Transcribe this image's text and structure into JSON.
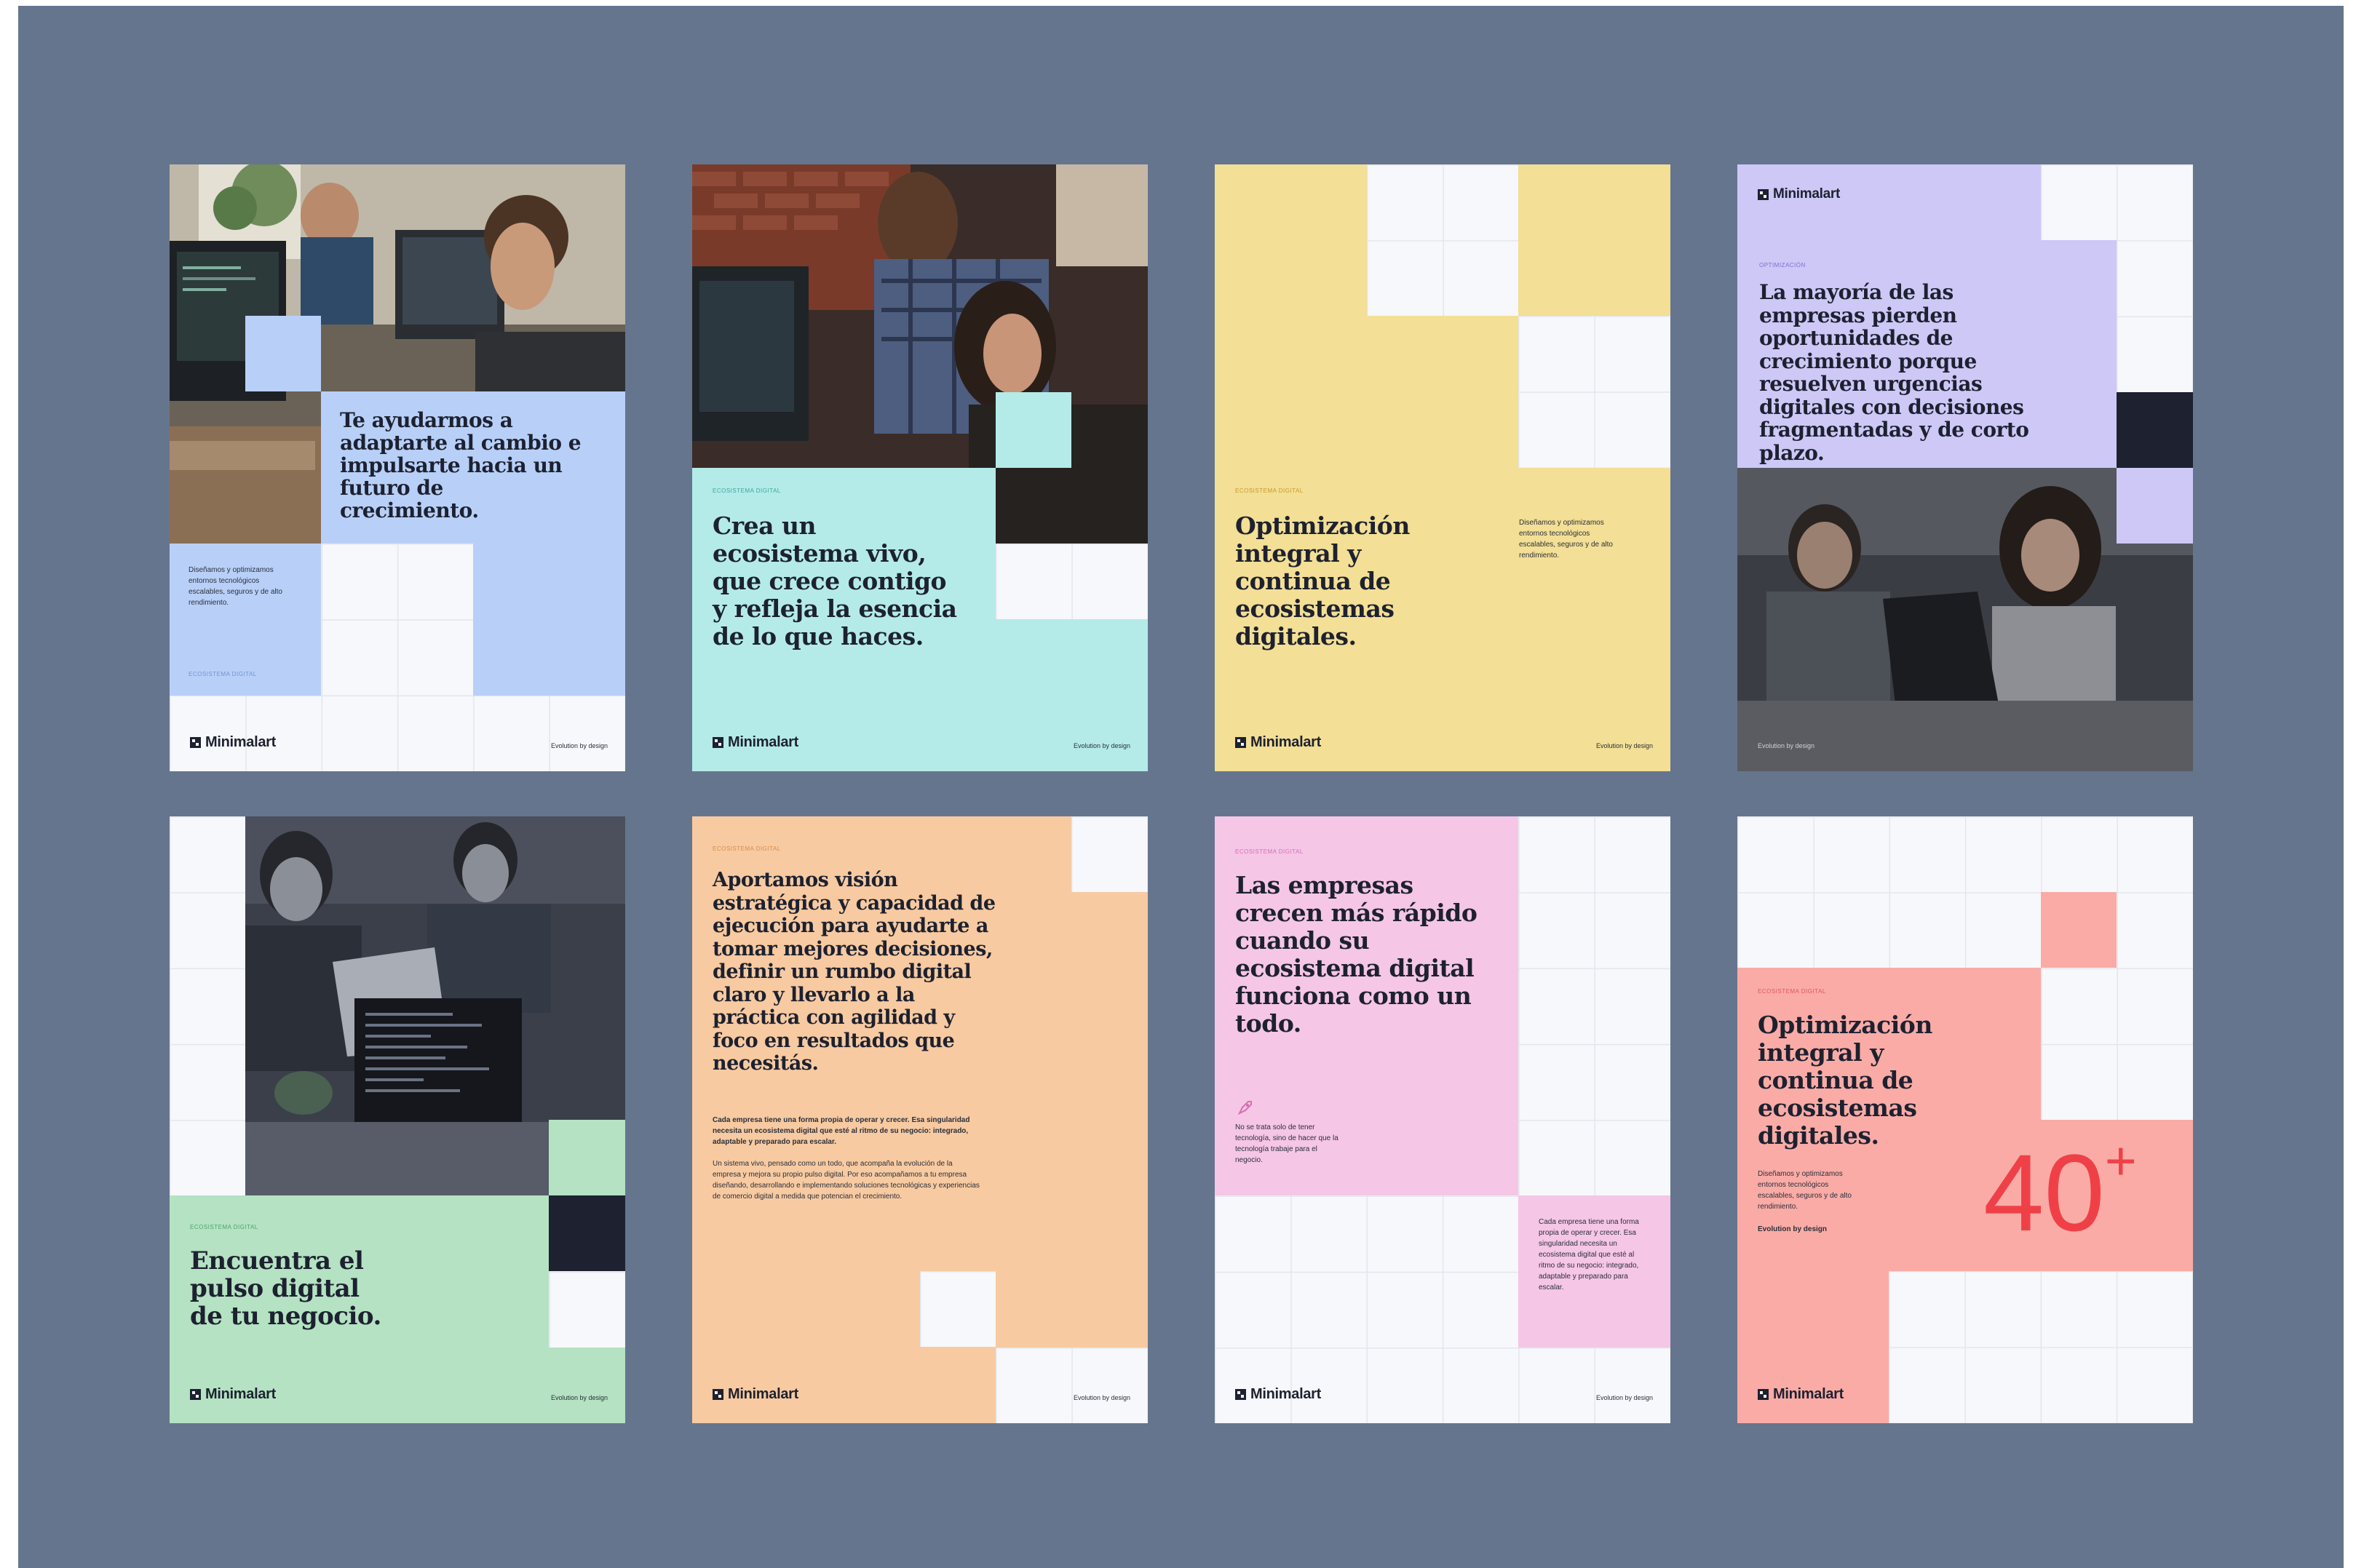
{
  "brand": {
    "name": "Minimalart",
    "tagline": "Evolution by design"
  },
  "colors": {
    "background": "#66758e",
    "blue": "#b8d0f8",
    "cyan": "#b4ebe8",
    "yellow": "#f3df95",
    "lavender": "#cdc8f6",
    "green": "#b4e2c2",
    "peach": "#f7caa1",
    "pink": "#f5c6e6",
    "salmon": "#faaba6",
    "accent_red": "#ef4048",
    "dark": "#1d2130"
  },
  "cards": [
    {
      "headline": "Te ayudarmos a adaptarte al cambio e impulsarte hacia un futuro de crecimiento.",
      "body": "Diseñamos y optimizamos entornos tecnológicos escalables, seguros y de alto rendimiento.",
      "eyebrow": "Ecosistema digital"
    },
    {
      "eyebrow": "Ecosistema digital",
      "headline": "Crea un ecosistema vivo, que crece contigo y refleja la esencia de lo que haces."
    },
    {
      "eyebrow": "Ecosistema digital",
      "headline": "Optimización integral y continua de ecosistemas digitales.",
      "body": "Diseñamos y optimizamos entornos tecnológicos escalables, seguros y de alto rendimiento."
    },
    {
      "eyebrow": "Optimización",
      "headline": "La mayoría de las empresas pierden oportunidades de crecimiento porque resuelven urgencias digitales con decisiones fragmentadas y de corto plazo."
    },
    {
      "eyebrow": "Ecosistema digital",
      "headline": "Encuentra el pulso digital de tu negocio."
    },
    {
      "eyebrow": "Ecosistema digital",
      "headline": "Aportamos visión estratégica y capacidad de ejecución para ayudarte a tomar mejores decisiones, definir un rumbo digital claro y llevarlo a la práctica con agilidad y foco en resultados que necesitás.",
      "body_bold": "Cada empresa tiene una forma propia de operar y crecer. Esa singularidad necesita un ecosistema digital que esté al ritmo de su negocio: integrado, adaptable y preparado para escalar.",
      "body": "Un sistema vivo, pensado como un todo, que acompaña la evolución de la empresa y mejora su propio pulso digital. Por eso acompañamos a tu empresa diseñando, desarrollando e implementando soluciones tecnológicas y experiencias de comercio digital a medida que potencian el crecimiento."
    },
    {
      "eyebrow": "Ecosistema digital",
      "headline": "Las empresas crecen más rápido cuando su ecosistema digital funciona como un todo.",
      "body": "No se trata solo de tener tecnología, sino de hacer que la tecnología trabaje para el negocio.",
      "side_text": "Cada empresa tiene una forma propia de operar y crecer. Esa singularidad necesita un ecosistema digital que esté al ritmo de su negocio: integrado, adaptable y preparado para escalar."
    },
    {
      "eyebrow": "Ecosistema digital",
      "headline": "Optimización integral y continua de ecosistemas digitales.",
      "body": "Diseñamos y optimizamos entornos tecnológicos escalables, seguros y de alto rendimiento.",
      "tagline": "Evolution by design",
      "stat_number": "40",
      "stat_suffix": "+"
    }
  ]
}
